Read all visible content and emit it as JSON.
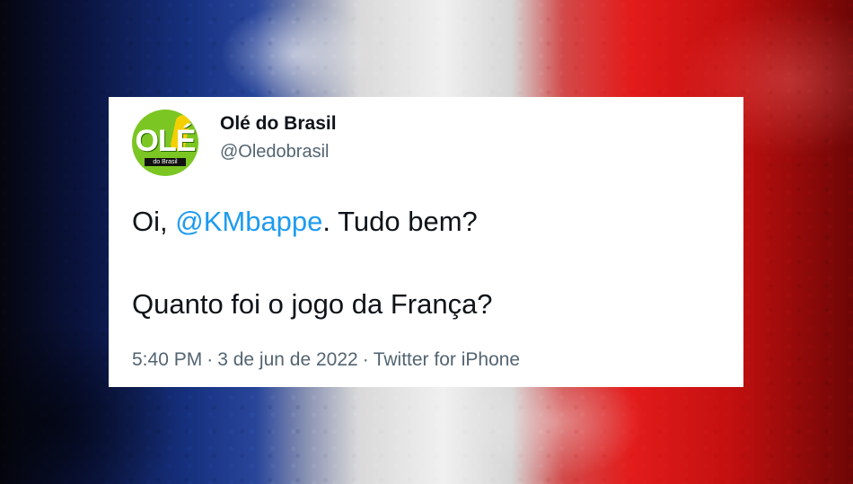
{
  "tweet": {
    "display_name": "Olé do Brasil",
    "handle": "@Oledobrasil",
    "avatar": {
      "logo_text": "OLÉ",
      "sub_text": "do Brasil"
    },
    "text": {
      "greeting": "Oi, ",
      "mention": "@KMbappe",
      "greeting_rest": ". Tudo bem?",
      "question": "Quanto foi o jogo da França?"
    },
    "time": "5:40 PM",
    "date": "3 de jun de 2022",
    "separator": "·",
    "source": "Twitter for iPhone"
  },
  "colors": {
    "mention": "#1d9bf0",
    "text": "#0f1419",
    "muted": "#536471",
    "avatar_green": "#7cc623",
    "avatar_yellow": "#f5d000"
  }
}
